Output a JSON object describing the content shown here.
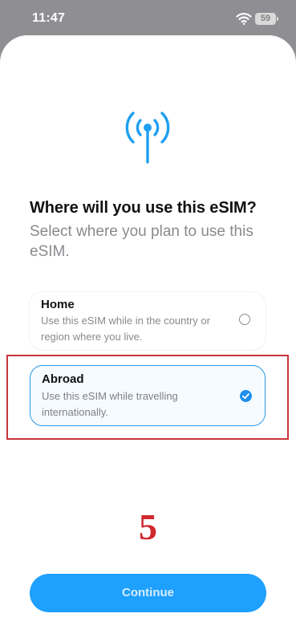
{
  "status_bar": {
    "time": "11:47",
    "battery": "59",
    "icons": [
      "wifi-icon",
      "battery-icon"
    ]
  },
  "header": {
    "icon": "antenna-icon",
    "title": "Where will you use this eSIM?",
    "subtitle": "Select where you plan to use this eSIM."
  },
  "options": [
    {
      "title": "Home",
      "description": "Use this eSIM while in the country or region where you live.",
      "selected": false
    },
    {
      "title": "Abroad",
      "description": "Use this eSIM while travelling internationally.",
      "selected": true
    }
  ],
  "annotation": {
    "step": "5"
  },
  "footer": {
    "continue_label": "Continue"
  },
  "colors": {
    "accent": "#1ea0ff",
    "highlight_box": "#c9343b",
    "step_number": "#d0292e",
    "check": "#1d8ff0"
  }
}
